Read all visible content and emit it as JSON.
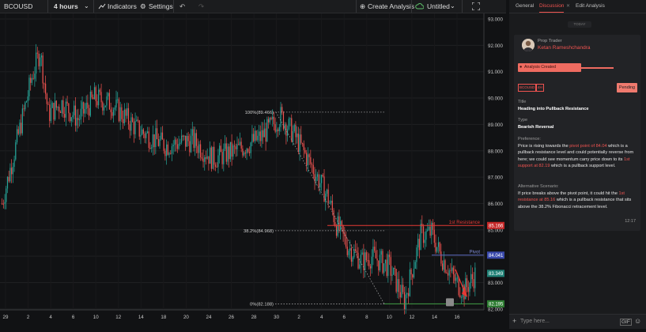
{
  "toolbar": {
    "symbol": "BCOUSD",
    "interval": "4 hours",
    "indicators": "Indicators",
    "settings": "Settings",
    "create_analysis": "Create Analysis",
    "layout_name": "Untitled"
  },
  "chart": {
    "y_ticks": [
      "93.000",
      "92.000",
      "91.000",
      "90.000",
      "89.000",
      "88.000",
      "87.000",
      "86.000",
      "85.000",
      "84.000",
      "83.000",
      "82.000"
    ],
    "x_ticks": [
      "29",
      "2",
      "4",
      "6",
      "10",
      "12",
      "14",
      "18",
      "20",
      "24",
      "26",
      "28",
      "30",
      "2",
      "4",
      "6",
      "8",
      "10",
      "12",
      "14",
      "16"
    ],
    "fib_100": "100%(89.466)",
    "fib_382": "38.2%(84.968)",
    "fib_0": "0%(82.188)",
    "resistance_label": "1st Resistance",
    "pivot_label": "Pivot",
    "price_badges": {
      "resistance": "85.166",
      "pivot": "84.041",
      "last": "83.349",
      "support": "82.195"
    },
    "colors": {
      "up": "#26a69a",
      "down": "#ef5350",
      "resistance": "#e53935",
      "pivot": "#5c6bc0",
      "support": "#43a047"
    }
  },
  "panel": {
    "tabs": [
      "General",
      "Discussion",
      "Edit Analysis"
    ],
    "active_tab": "Discussion",
    "today": "TODAY",
    "author_role": "Prop Trader",
    "author_name": "Ketan Rameshchandra",
    "banner": "Analysis Created",
    "chip_symbol": "BCOUSD",
    "chip_tf": "4H",
    "status": "Pending",
    "title_label": "Title",
    "title_value": "Heading into Pullback Resistance",
    "type_label": "Type",
    "type_value": "Bearish Reversal",
    "pref_label": "Preference:",
    "pref_1": "Price is rising towards the ",
    "pref_hl1": "pivot point of 84.04",
    "pref_2": " which is a pullback resistance level and could potentially reverse from here; we could see momentum carry price down to its ",
    "pref_hl2": "1st support at 82.19",
    "pref_3": " which is a pullback support level.",
    "alt_label": "Alternative Scenario:",
    "alt_1": "If price breaks above the pivot point, it could hit the ",
    "alt_hl": "1st resistance at 85.16",
    "alt_2": " which is a pullback resistance that sits above the 38.2% Fibonacci retracement level.",
    "time": "12:17",
    "input_placeholder": "Type here...",
    "gif": "GIF"
  }
}
